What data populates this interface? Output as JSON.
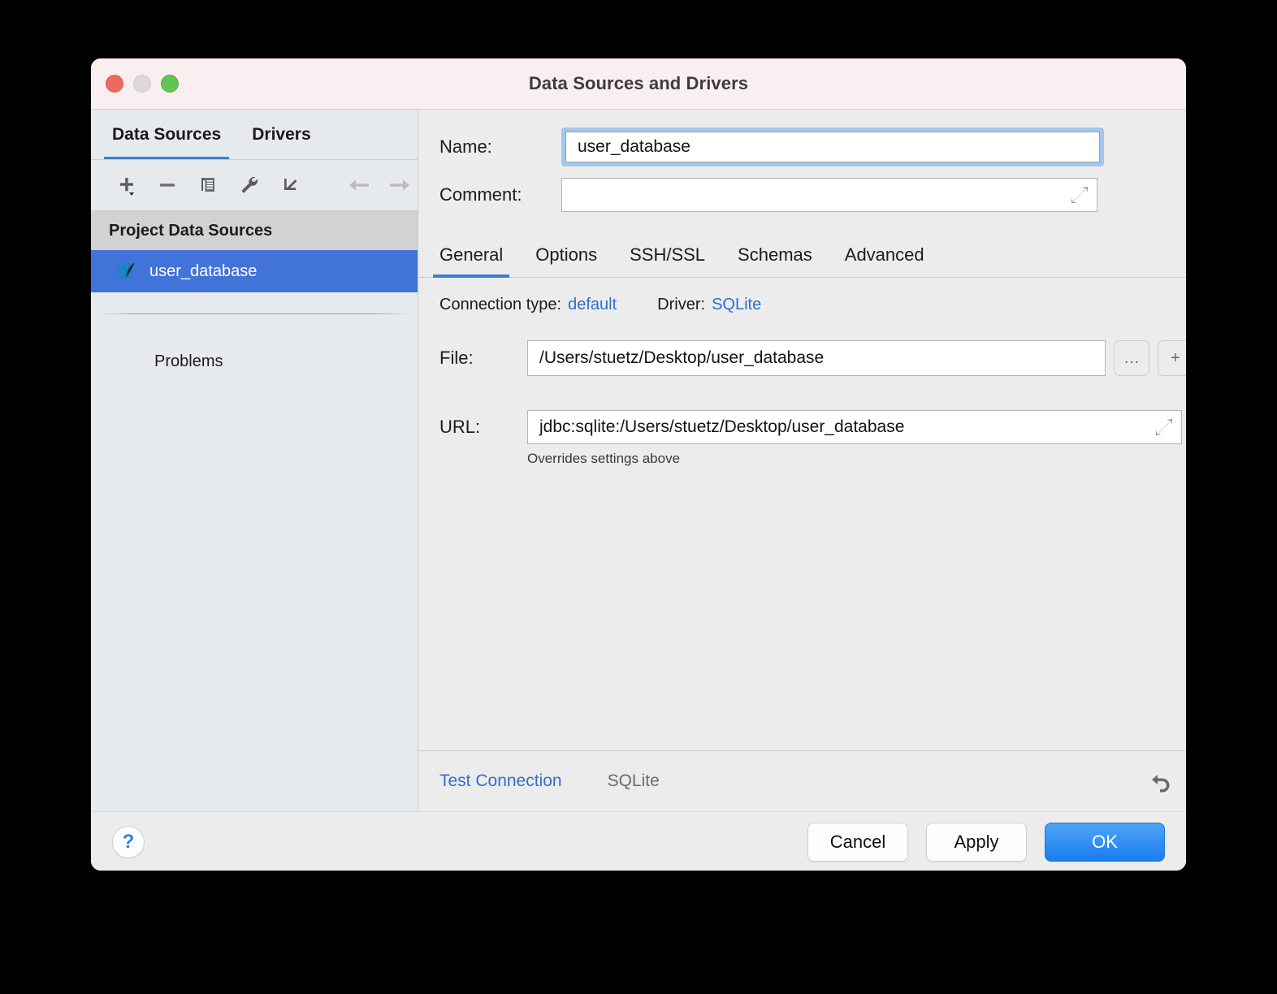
{
  "window": {
    "title": "Data Sources and Drivers",
    "traffic_lights": [
      "close",
      "minimize",
      "zoom"
    ],
    "colors": {
      "titlebar_bg": "#faeff0",
      "accent_blue": "#3b7fd4",
      "selection_blue": "#4273d8",
      "link_blue": "#2f6fce",
      "primary_button": "#1a7ef0"
    }
  },
  "sidebar": {
    "tabs": [
      {
        "label": "Data Sources",
        "active": true
      },
      {
        "label": "Drivers",
        "active": false
      }
    ],
    "toolbar": [
      {
        "name": "add-data-source-button",
        "icon": "plus-dropdown-icon",
        "enabled": true
      },
      {
        "name": "remove-data-source-button",
        "icon": "minus-icon",
        "enabled": true
      },
      {
        "name": "duplicate-data-source-button",
        "icon": "copy-icon",
        "enabled": true
      },
      {
        "name": "properties-button",
        "icon": "wrench-icon",
        "enabled": true
      },
      {
        "name": "import-data-source-button",
        "icon": "import-arrow-icon",
        "enabled": true
      },
      {
        "name": "navigate-back-button",
        "icon": "arrow-left-icon",
        "enabled": false
      },
      {
        "name": "navigate-forward-button",
        "icon": "arrow-right-icon",
        "enabled": false
      }
    ],
    "group_header": "Project Data Sources",
    "items": [
      {
        "label": "user_database",
        "icon": "sqlite-feather-icon",
        "selected": true
      }
    ],
    "problems_label": "Problems"
  },
  "main": {
    "name": {
      "label": "Name:",
      "value": "user_database",
      "placeholder": "",
      "color_chip": "circle-icon",
      "focused": true
    },
    "comment": {
      "label": "Comment:",
      "value": "",
      "placeholder": "",
      "expand_icon": "expand-diagonal-icon"
    },
    "tabs": [
      {
        "label": "General",
        "active": true
      },
      {
        "label": "Options",
        "active": false
      },
      {
        "label": "SSH/SSL",
        "active": false
      },
      {
        "label": "Schemas",
        "active": false
      },
      {
        "label": "Advanced",
        "active": false
      }
    ],
    "connection": {
      "type_label": "Connection type:",
      "type_value": "default",
      "driver_label": "Driver:",
      "driver_value": "SQLite"
    },
    "file": {
      "label": "File:",
      "value": "/Users/stuetz/Desktop/user_database",
      "browse_button": "…",
      "add_button": "+"
    },
    "url": {
      "label": "URL:",
      "value": "jdbc:sqlite:/Users/stuetz/Desktop/user_database",
      "hint": "Overrides settings above",
      "expand_icon": "expand-diagonal-icon"
    },
    "footer": {
      "test_connection": "Test Connection",
      "driver_status": "SQLite",
      "revert_icon": "revert-arrow-icon"
    }
  },
  "dialog_footer": {
    "help": "?",
    "buttons": [
      {
        "label": "Cancel",
        "style": "plain"
      },
      {
        "label": "Apply",
        "style": "plain"
      },
      {
        "label": "OK",
        "style": "primary"
      }
    ]
  }
}
